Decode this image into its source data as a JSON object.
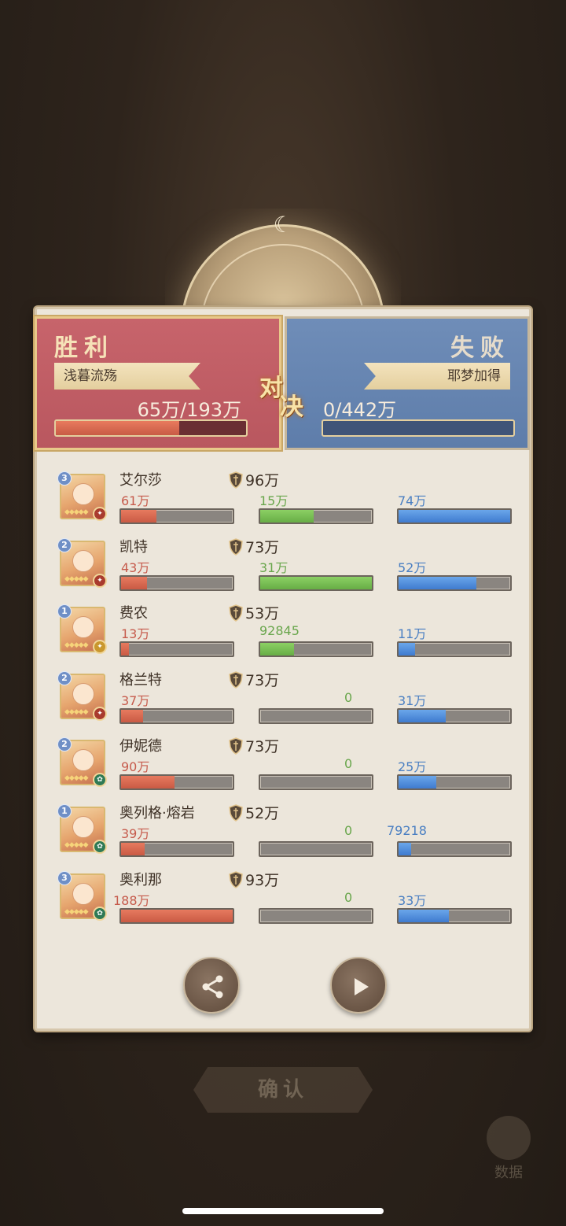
{
  "header": {
    "win_label": "胜利",
    "lose_label": "失败",
    "vs_char_1": "对",
    "vs_char_2": "决"
  },
  "teams": {
    "win": {
      "player": "浅暮流殇",
      "score_text": "65万/193万",
      "progress": 0.65
    },
    "lose": {
      "player": "耶梦加得",
      "score_text": "0/442万",
      "progress": 0.0
    }
  },
  "heroes": [
    {
      "level": "3",
      "name": "艾尔莎",
      "power": "96万",
      "damage": "61万",
      "heal": "15万",
      "tank": "74万",
      "damage_ratio": 0.32,
      "heal_ratio": 0.48,
      "tank_ratio": 1.0,
      "faction": "red"
    },
    {
      "level": "2",
      "name": "凯特",
      "power": "73万",
      "damage": "43万",
      "heal": "31万",
      "tank": "52万",
      "damage_ratio": 0.23,
      "heal_ratio": 1.0,
      "tank_ratio": 0.7,
      "faction": "red"
    },
    {
      "level": "1",
      "name": "费农",
      "power": "53万",
      "damage": "13万",
      "heal": "92845",
      "tank": "11万",
      "damage_ratio": 0.07,
      "heal_ratio": 0.3,
      "tank_ratio": 0.15,
      "faction": "gold"
    },
    {
      "level": "2",
      "name": "格兰特",
      "power": "73万",
      "damage": "37万",
      "heal": "0",
      "tank": "31万",
      "damage_ratio": 0.2,
      "heal_ratio": 0.0,
      "tank_ratio": 0.42,
      "faction": "red"
    },
    {
      "level": "2",
      "name": "伊妮德",
      "power": "73万",
      "damage": "90万",
      "heal": "0",
      "tank": "25万",
      "damage_ratio": 0.48,
      "heal_ratio": 0.0,
      "tank_ratio": 0.34,
      "faction": "green"
    },
    {
      "level": "1",
      "name": "奥列格·熔岩",
      "power": "52万",
      "damage": "39万",
      "heal": "0",
      "tank": "79218",
      "damage_ratio": 0.21,
      "heal_ratio": 0.0,
      "tank_ratio": 0.11,
      "faction": "green"
    },
    {
      "level": "3",
      "name": "奥利那",
      "power": "93万",
      "damage": "188万",
      "heal": "0",
      "tank": "33万",
      "damage_ratio": 1.0,
      "heal_ratio": 0.0,
      "tank_ratio": 0.45,
      "faction": "green"
    }
  ],
  "footer": {
    "confirm_label": "确认",
    "data_label": "数据"
  },
  "icons": {
    "share": "share-icon",
    "play": "play-icon",
    "power": "shield-power-icon",
    "data": "bar-chart-icon"
  },
  "colors": {
    "win_panel": "#c7646b",
    "lose_panel": "#6f8db8",
    "damage": "#c65b4c",
    "heal": "#69a64c",
    "tank": "#4a7fc2"
  }
}
